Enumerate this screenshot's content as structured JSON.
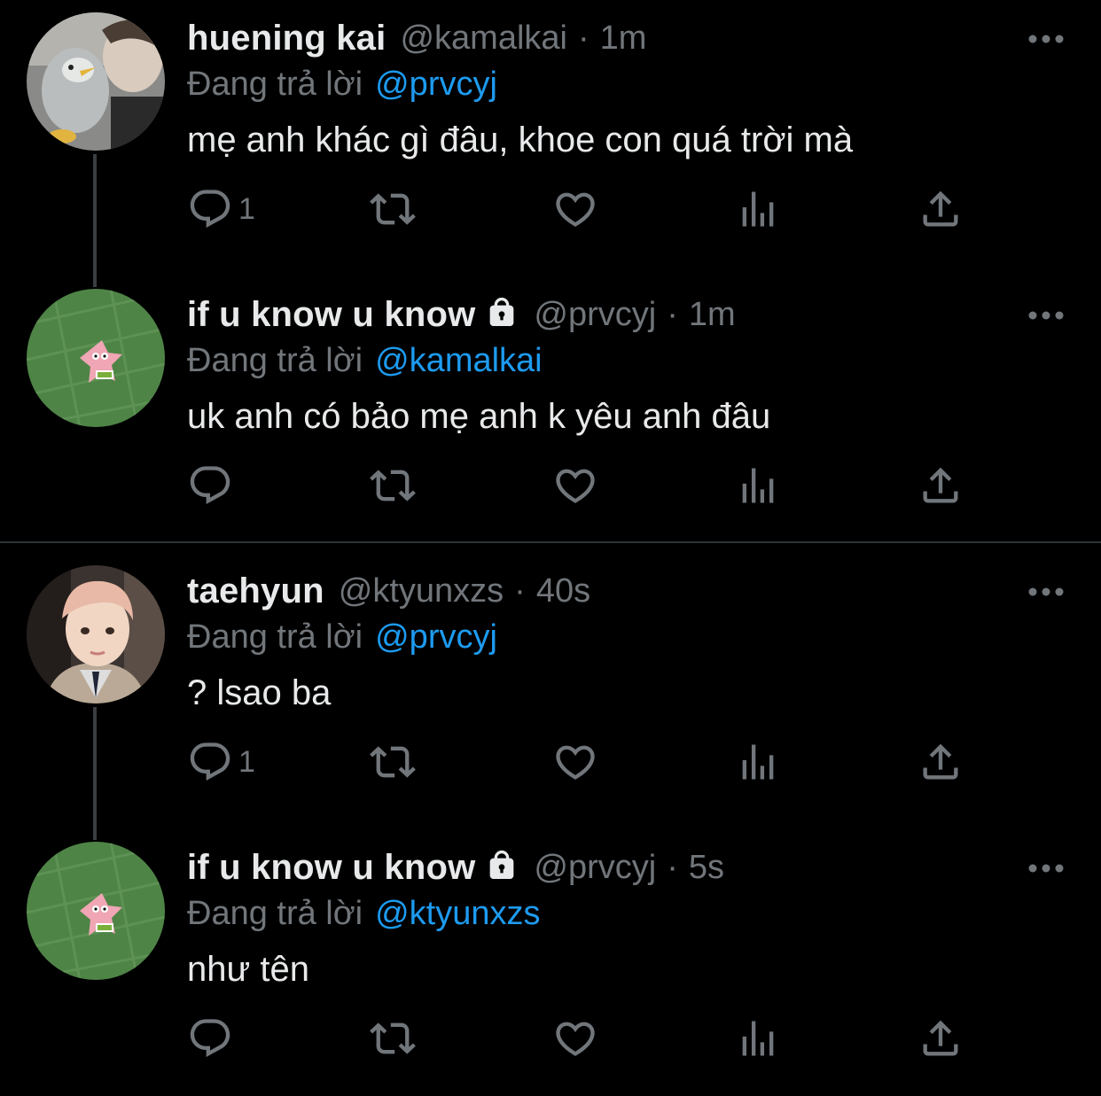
{
  "colors": {
    "background": "#000000",
    "text": "#e7e9ea",
    "muted": "#71767b",
    "link": "#1d9bf0",
    "thread_line": "#3a3e42"
  },
  "tweets": [
    {
      "display_name": "huening kai",
      "handle": "@kamalkai",
      "separator": "·",
      "time": "1m",
      "replying_label": "Đang trả lời",
      "replying_to": "@prvcyj",
      "text": "mẹ anh khác gì đâu, khoe con quá trời mà",
      "reply_count": "1",
      "protected": false,
      "avatar": "huening-kai-avatar"
    },
    {
      "display_name": "if u know u know",
      "handle": "@prvcyj",
      "separator": "·",
      "time": "1m",
      "replying_label": "Đang trả lời",
      "replying_to": "@kamalkai",
      "text": "uk anh có bảo mẹ anh k yêu anh đâu",
      "reply_count": "",
      "protected": true,
      "avatar": "patrick-grass-avatar"
    },
    {
      "display_name": "taehyun",
      "handle": "@ktyunxzs",
      "separator": "·",
      "time": "40s",
      "replying_label": "Đang trả lời",
      "replying_to": "@prvcyj",
      "text": "? lsao ba",
      "reply_count": "1",
      "protected": false,
      "avatar": "taehyun-avatar"
    },
    {
      "display_name": "if u know u know",
      "handle": "@prvcyj",
      "separator": "·",
      "time": "5s",
      "replying_label": "Đang trả lời",
      "replying_to": "@ktyunxzs",
      "text": "như tên",
      "reply_count": "",
      "protected": true,
      "avatar": "patrick-grass-avatar"
    }
  ],
  "icons": [
    "reply-icon",
    "retweet-icon",
    "like-icon",
    "analytics-icon",
    "share-icon",
    "more-icon",
    "lock-icon"
  ]
}
